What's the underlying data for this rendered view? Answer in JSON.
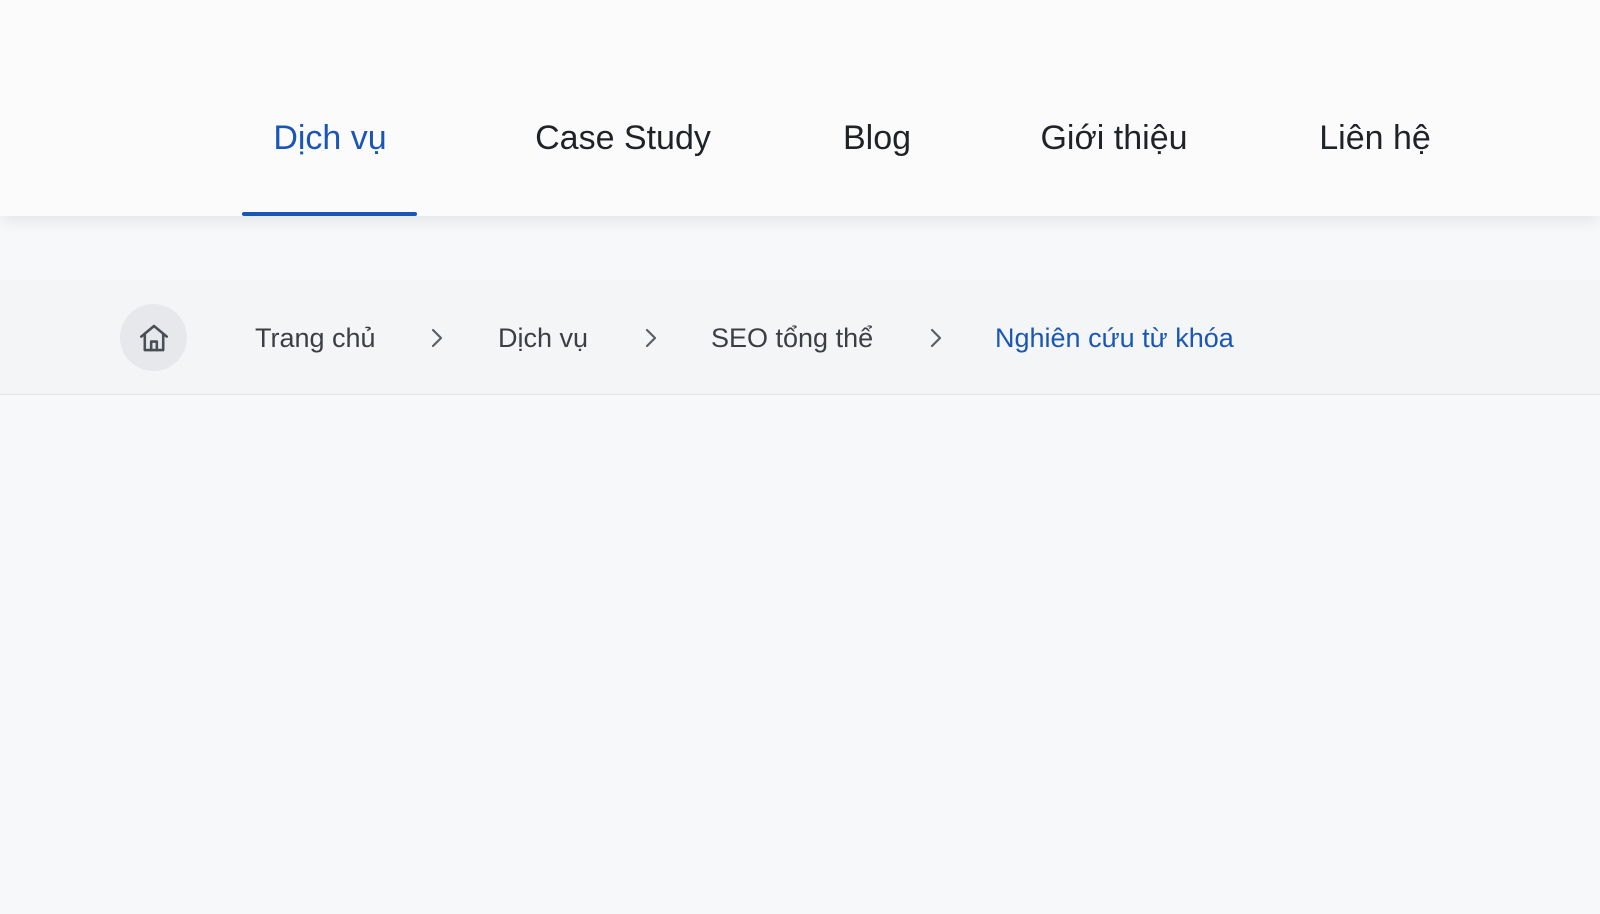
{
  "nav": {
    "items": [
      {
        "label": "Dịch vụ",
        "active": true
      },
      {
        "label": "Case Study",
        "active": false
      },
      {
        "label": "Blog",
        "active": false
      },
      {
        "label": "Giới thiệu",
        "active": false
      },
      {
        "label": "Liên hệ",
        "active": false
      }
    ]
  },
  "breadcrumb": {
    "home_icon": "home-icon",
    "separator_icon": "chevron-right-icon",
    "items": [
      {
        "label": "Trang chủ"
      },
      {
        "label": "Dịch vụ"
      },
      {
        "label": "SEO tổng thể"
      },
      {
        "label": "Nghiên cứu từ khóa",
        "current": true
      }
    ]
  },
  "colors": {
    "accent": "#1a57b5",
    "text": "#1f2328",
    "muted_text": "#3b3f45",
    "background": "#f7f8fa"
  }
}
